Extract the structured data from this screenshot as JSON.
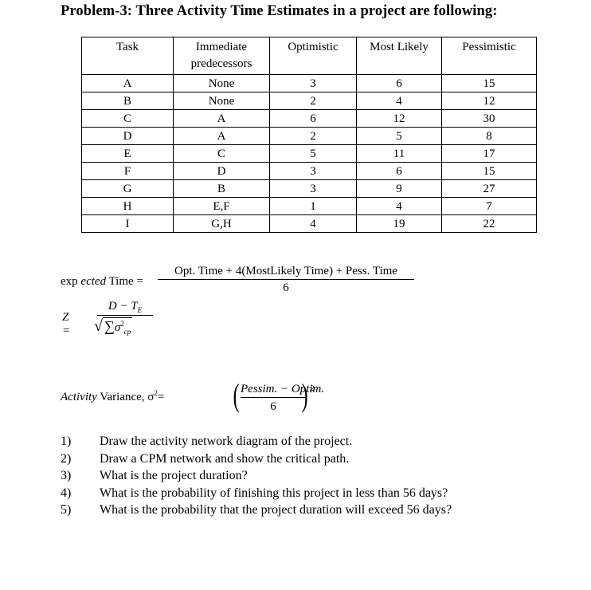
{
  "title": "Problem-3: Three Activity Time Estimates in a project are following:",
  "table": {
    "headers": [
      "Task",
      "Immediate predecessors",
      "Optimistic",
      "Most Likely",
      "Pessimistic"
    ],
    "rows": [
      [
        "A",
        "None",
        "3",
        "6",
        "15"
      ],
      [
        "B",
        "None",
        "2",
        "4",
        "12"
      ],
      [
        "C",
        "A",
        "6",
        "12",
        "30"
      ],
      [
        "D",
        "A",
        "2",
        "5",
        "8"
      ],
      [
        "E",
        "C",
        "5",
        "11",
        "17"
      ],
      [
        "F",
        "D",
        "3",
        "6",
        "15"
      ],
      [
        "G",
        "B",
        "3",
        "9",
        "27"
      ],
      [
        "H",
        "E,F",
        "1",
        "4",
        "7"
      ],
      [
        "I",
        "G,H",
        "4",
        "19",
        "22"
      ]
    ]
  },
  "formulas": {
    "expected_time": {
      "lhs_exp": "exp",
      "lhs_ected": "ected",
      "lhs_rest": "Time =",
      "numerator": "Opt. Time + 4(MostLikely Time) + Pess. Time",
      "denominator": "6"
    },
    "z_score": {
      "lhs": "Z =",
      "numerator_d": "D",
      "numerator_minus": " − T",
      "numerator_sub": "E",
      "sqrt_symbol": "√",
      "sigma_sum": "∑",
      "sigma": "σ",
      "sigma_sup": "2",
      "sigma_sub": "cp"
    },
    "activity_variance": {
      "lhs_activity": "Activity",
      "lhs_rest": "Variance, σ",
      "lhs_sup": "2",
      "eq": "=",
      "numerator": "Pessim. − Optim.",
      "denominator": "6",
      "exponent": "2",
      "lparen": "(",
      "rparen": ")"
    }
  },
  "questions": [
    {
      "num": "1)",
      "text": "Draw the activity network diagram of the project."
    },
    {
      "num": "2)",
      "text": "Draw a CPM network and show the critical path."
    },
    {
      "num": "3)",
      "text": "What is the project duration?"
    },
    {
      "num": "4)",
      "text": "What is the probability of finishing this project in less than 56 days?"
    },
    {
      "num": "5)",
      "text": "What is the probability that the project duration will exceed 56 days?"
    }
  ]
}
